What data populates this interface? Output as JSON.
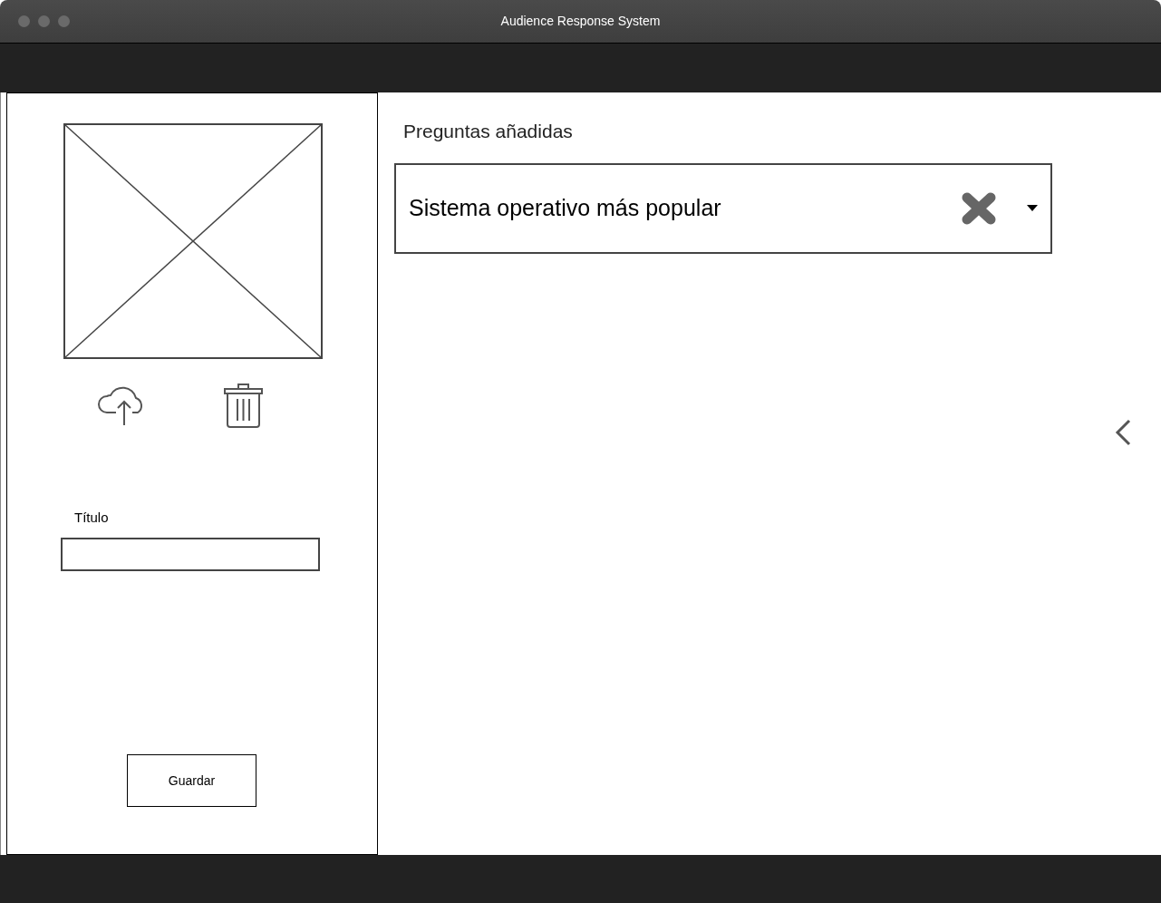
{
  "window": {
    "title": "Audience Response System"
  },
  "editor": {
    "title_label": "Título",
    "save_button": "Guardar"
  },
  "questions_panel": {
    "heading": "Preguntas añadidas",
    "questions": [
      {
        "text": "Sistema operativo más popular"
      }
    ]
  }
}
